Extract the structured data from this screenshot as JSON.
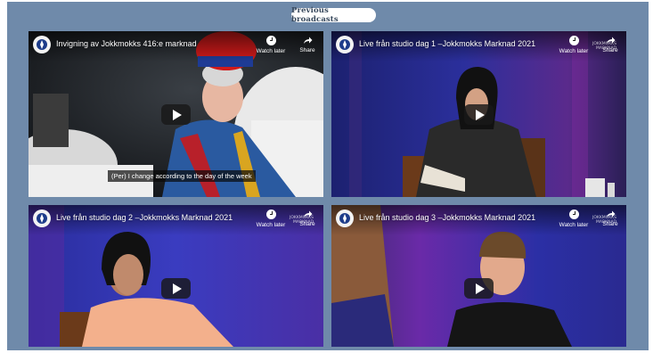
{
  "section": {
    "title": "Previous broadcasts"
  },
  "videos": [
    {
      "title": "Invigning av Jokkmokks 416:e marknad",
      "watch_later": "Watch later",
      "share": "Share",
      "caption": "(Per) I change according to the day of the week"
    },
    {
      "title": "Live från studio dag 1 –Jokkmokks Marknad 2021",
      "watch_later": "Watch later",
      "share": "Share"
    },
    {
      "title": "Live från studio dag 2 –Jokkmokks Marknad 2021",
      "watch_later": "Watch later",
      "share": "Share"
    },
    {
      "title": "Live från studio dag 3 –Jokkmokks Marknad 2021",
      "watch_later": "Watch later",
      "share": "Share"
    }
  ],
  "watermark": "JOKKMOKKS MARKNAD",
  "colors": {
    "panel": "#6f8aaa",
    "pill_text": "#394a5e",
    "studio_blue": "#2a2f9a",
    "studio_purple": "#6a2aa0"
  },
  "icons": [
    "channel-logo-icon",
    "clock-icon",
    "share-arrow-icon",
    "play-icon"
  ]
}
